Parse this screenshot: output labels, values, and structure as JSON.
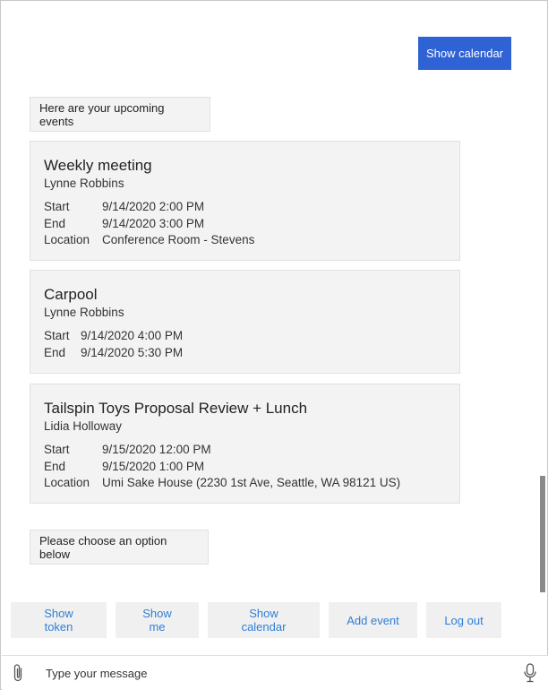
{
  "user_message": "Show calendar",
  "bot_messages": {
    "intro": "Here are your upcoming events",
    "prompt": "Please choose an option below"
  },
  "events": [
    {
      "title": "Weekly meeting",
      "organizer": "Lynne Robbins",
      "facts": [
        {
          "key": "Start",
          "value": "9/14/2020 2:00 PM"
        },
        {
          "key": "End",
          "value": "9/14/2020 3:00 PM"
        },
        {
          "key": "Location",
          "value": "Conference Room - Stevens"
        }
      ]
    },
    {
      "title": "Carpool",
      "organizer": "Lynne Robbins",
      "facts": [
        {
          "key": "Start",
          "value": "9/14/2020 4:00 PM"
        },
        {
          "key": "End",
          "value": "9/14/2020 5:30 PM"
        }
      ]
    },
    {
      "title": "Tailspin Toys Proposal Review + Lunch",
      "organizer": "Lidia Holloway",
      "facts": [
        {
          "key": "Start",
          "value": "9/15/2020 12:00 PM"
        },
        {
          "key": "End",
          "value": "9/15/2020 1:00 PM"
        },
        {
          "key": "Location",
          "value": "Umi Sake House (2230 1st Ave, Seattle, WA 98121 US)"
        }
      ]
    }
  ],
  "suggested_actions": [
    "Show token",
    "Show me",
    "Show calendar",
    "Add event",
    "Log out"
  ],
  "composer": {
    "placeholder": "Type your message",
    "attach_icon": "paperclip-icon",
    "mic_icon": "microphone-icon"
  },
  "colors": {
    "user_bubble": "#2f62d4",
    "action_text": "#2f7fd8",
    "card_bg": "#f3f3f3"
  }
}
